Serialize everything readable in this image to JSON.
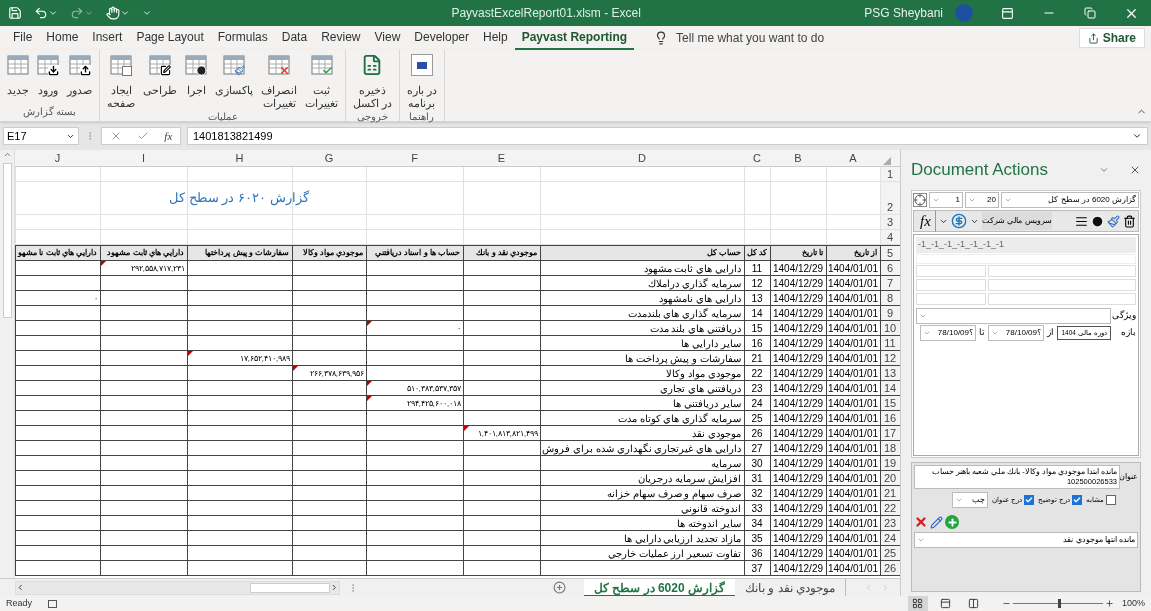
{
  "title_bar": {
    "title": "PayvastExcelReport01.xlsm  -  Excel",
    "user": "PSG Sheybani"
  },
  "menu_tabs": [
    {
      "label": "Payvast Reporting",
      "selected": true
    },
    {
      "label": "Help",
      "selected": false
    },
    {
      "label": "Developer",
      "selected": false
    },
    {
      "label": "View",
      "selected": false
    },
    {
      "label": "Review",
      "selected": false
    },
    {
      "label": "Data",
      "selected": false
    },
    {
      "label": "Formulas",
      "selected": false
    },
    {
      "label": "Page Layout",
      "selected": false
    },
    {
      "label": "Insert",
      "selected": false
    },
    {
      "label": "Home",
      "selected": false
    },
    {
      "label": "File",
      "selected": false
    }
  ],
  "tell_me": "Tell me what you want to do",
  "share": "Share",
  "ribbon_groups": [
    {
      "label": "راهنما",
      "buttons": [
        {
          "kind": "about",
          "lines": [
            "در باره",
            "برنامه"
          ]
        }
      ]
    },
    {
      "label": "خروجی",
      "buttons": [
        {
          "kind": "excel",
          "lines": [
            "ذخیره",
            "در اکسل"
          ]
        }
      ]
    },
    {
      "label": "عملیات",
      "buttons": [
        {
          "kind": "save",
          "lines": [
            "ثبت",
            "تغییرات"
          ]
        },
        {
          "kind": "cancel",
          "lines": [
            "انصراف",
            "تغییرات"
          ]
        },
        {
          "kind": "clean",
          "lines": [
            "پاکسازی"
          ]
        },
        {
          "kind": "run",
          "lines": [
            "اجرا"
          ]
        },
        {
          "kind": "edit",
          "lines": [
            "طراحی"
          ]
        },
        {
          "kind": "pages",
          "lines": [
            "ایجاد",
            "صفحه"
          ]
        }
      ]
    },
    {
      "label": "بسته گزارش",
      "buttons": [
        {
          "kind": "export",
          "lines": [
            "صدور"
          ]
        },
        {
          "kind": "import",
          "lines": [
            "ورود"
          ]
        },
        {
          "kind": "new",
          "lines": [
            "جدید"
          ]
        }
      ]
    }
  ],
  "formula_bar": {
    "name_box": "E17",
    "function_label": "fx",
    "formula": "1401813821499"
  },
  "sheet": {
    "columns": [
      "A",
      "B",
      "C",
      "D",
      "E",
      "F",
      "G",
      "H",
      "I",
      "J"
    ],
    "rows": [
      {
        "number": "1",
        "kind": "blank"
      },
      {
        "number": "2",
        "kind": "title",
        "title": "گزارش ۶۰۲۰ در سطح کل"
      },
      {
        "number": "3",
        "kind": "blank"
      },
      {
        "number": "4",
        "kind": "blank"
      },
      {
        "number": "5",
        "kind": "header",
        "cells": [
          "از تاریخ",
          "تا تاریخ",
          "کد کل",
          "حساب کل",
          "موجودي نقد و بانك",
          "حساب ها و اسناد دريافتني",
          "موجودي مواد وكالا",
          "سفارشات و پيش پرداختها",
          "دارايي هاي ثابت مشهود",
          "دارايي هاي ثابت نا مشهو"
        ]
      },
      {
        "number": "6",
        "kind": "data",
        "from": "1404/01/01",
        "to": "1404/12/29",
        "code": "11",
        "account": "دارايي هاي ثابت مشهود",
        "amounts": {
          "I": {
            "value": "۲۹۲,۵۵۸,۷۱۷,۲۳۱",
            "comment": true
          }
        }
      },
      {
        "number": "7",
        "kind": "data",
        "from": "1404/01/01",
        "to": "1404/12/29",
        "code": "12",
        "account": "سرمايه گذاري دراملاك"
      },
      {
        "number": "8",
        "kind": "data",
        "from": "1404/01/01",
        "to": "1404/12/29",
        "code": "13",
        "account": "دارايي هاي نامشهود",
        "amounts": {
          "J": {
            "value": "۰",
            "comment": false
          }
        }
      },
      {
        "number": "9",
        "kind": "data",
        "from": "1404/01/01",
        "to": "1404/12/29",
        "code": "14",
        "account": "سرمايه گذاري هاي بلندمدت"
      },
      {
        "number": "10",
        "kind": "data",
        "from": "1404/01/01",
        "to": "1404/12/29",
        "code": "15",
        "account": "دريافتني هاي بلند مدت",
        "amounts": {
          "F": {
            "value": "۰",
            "comment": true
          }
        }
      },
      {
        "number": "11",
        "kind": "data",
        "from": "1404/01/01",
        "to": "1404/12/29",
        "code": "16",
        "account": "ساير دارايي ها"
      },
      {
        "number": "12",
        "kind": "data",
        "from": "1404/01/01",
        "to": "1404/12/29",
        "code": "21",
        "account": "سفارشات و پيش پرداخت ها",
        "amounts": {
          "H": {
            "value": "۱۷,۶۵۲,۴۱۰,۹۸۹",
            "comment": true
          }
        }
      },
      {
        "number": "13",
        "kind": "data",
        "from": "1404/01/01",
        "to": "1404/12/29",
        "code": "22",
        "account": "موجودي مواد وكالا",
        "amounts": {
          "G": {
            "value": "۲۶۶,۳۷۸,۶۳۹,۹۵۶",
            "comment": true
          }
        }
      },
      {
        "number": "14",
        "kind": "data",
        "from": "1404/01/01",
        "to": "1404/12/29",
        "code": "23",
        "account": "دريافتني هاي تجاري",
        "amounts": {
          "F": {
            "value": "۵۱۰,۳۸۳,۵۳۷,۳۵۷",
            "comment": true
          }
        }
      },
      {
        "number": "15",
        "kind": "data",
        "from": "1404/01/01",
        "to": "1404/12/29",
        "code": "24",
        "account": "ساير دريافتني ها",
        "amounts": {
          "F": {
            "value": "۲۹۴,۴۲۵,۶۰۰,۰۱۸",
            "comment": true
          }
        }
      },
      {
        "number": "16",
        "kind": "data",
        "from": "1404/01/01",
        "to": "1404/12/29",
        "code": "25",
        "account": "سرمايه گذاري هاي كوتاه مدت"
      },
      {
        "number": "17",
        "kind": "data",
        "from": "1404/01/01",
        "to": "1404/12/29",
        "code": "26",
        "account": "موجودي نقد",
        "amounts": {
          "E": {
            "value": "۱,۴۰۱,۸۱۳,۸۲۱,۴۹۹",
            "comment": true
          }
        }
      },
      {
        "number": "18",
        "kind": "data",
        "from": "1404/01/01",
        "to": "1404/12/29",
        "code": "27",
        "account": "دارايي هاي غيرتجاري نگهداري شده براي فروش"
      },
      {
        "number": "19",
        "kind": "data",
        "from": "1404/01/01",
        "to": "1404/12/29",
        "code": "30",
        "account": "سرمايه"
      },
      {
        "number": "20",
        "kind": "data",
        "from": "1404/01/01",
        "to": "1404/12/29",
        "code": "31",
        "account": "افزايش سرمايه درجريان"
      },
      {
        "number": "21",
        "kind": "data",
        "from": "1404/01/01",
        "to": "1404/12/29",
        "code": "32",
        "account": "صرف سهام و صرف سهام خزانه"
      },
      {
        "number": "22",
        "kind": "data",
        "from": "1404/01/01",
        "to": "1404/12/29",
        "code": "33",
        "account": "اندوخته قانوني"
      },
      {
        "number": "23",
        "kind": "data",
        "from": "1404/01/01",
        "to": "1404/12/29",
        "code": "34",
        "account": "ساير اندوخته ها"
      },
      {
        "number": "24",
        "kind": "data",
        "from": "1404/01/01",
        "to": "1404/12/29",
        "code": "35",
        "account": "مازاد تجديد ارزيابي دارايي ها"
      },
      {
        "number": "25",
        "kind": "data",
        "from": "1404/01/01",
        "to": "1404/12/29",
        "code": "36",
        "account": "تفاوت تسعير ارز عمليات خارجي"
      },
      {
        "number": "26",
        "kind": "data",
        "from": "1404/01/01",
        "to": "1404/12/29",
        "code": "37"
      }
    ]
  },
  "sheet_tabs": [
    {
      "label": "موجودي نقد و بانك",
      "selected": false
    },
    {
      "label": "گزارش 6020 در سطح کل",
      "selected": true
    }
  ],
  "document_actions": {
    "title": "Document Actions",
    "page_select": "1",
    "size_select": "20",
    "report_select": "گزارش 6020 در سطح کل",
    "function_label": "fx",
    "service_field": "سرويس مالي شركت",
    "list_item": "-1_-1_-1_-1_-1_-1_-1",
    "feature_label": "ویژگی",
    "range_label": "بازه",
    "period": "دوره مالی 1404",
    "from_label": "از",
    "from_date": "؟78/10/09",
    "to_label": "تا",
    "to_date": "؟78/10/09",
    "title_label": "عنوان",
    "title_value": "مانده ابتدا   موجودي مواد وكالا- بانك ملي شعبه باهنر حساب 102500026533",
    "options": [
      {
        "label": "مشابه",
        "checked": false
      },
      {
        "label": "درج توضيح",
        "checked": true
      },
      {
        "label": "درج عنوان",
        "checked": true
      }
    ],
    "align_select": "چپ",
    "end_select": "مانده انتها   موجودي نقد"
  },
  "status_bar": {
    "status": "Ready",
    "views": [
      {
        "kind": "normal",
        "selected": true
      },
      {
        "kind": "page_layout",
        "selected": false
      },
      {
        "kind": "page_break",
        "selected": false
      }
    ],
    "zoom": {
      "label": "100%",
      "level": 0.5
    }
  }
}
